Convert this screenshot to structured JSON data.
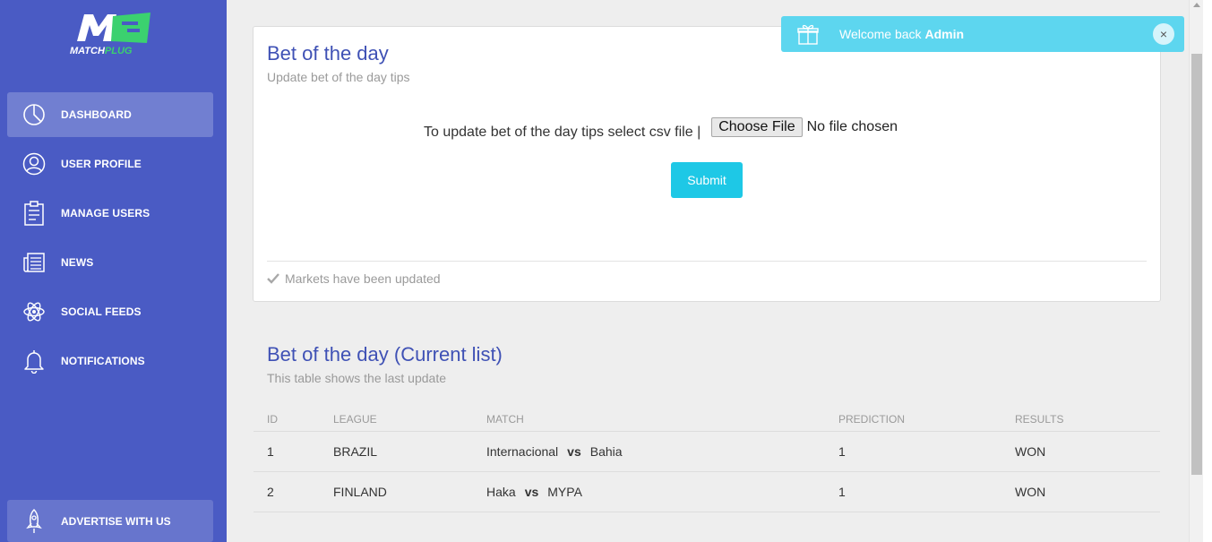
{
  "brand": {
    "logo_mark": "M",
    "logo_text_part1": "MATCH",
    "logo_text_part2": "PLUG"
  },
  "sidebar": {
    "items": [
      {
        "label": "DASHBOARD",
        "icon": "pie-chart-icon",
        "active": true
      },
      {
        "label": "USER PROFILE",
        "icon": "user-icon",
        "active": false
      },
      {
        "label": "MANAGE USERS",
        "icon": "clipboard-icon",
        "active": false
      },
      {
        "label": "NEWS",
        "icon": "newspaper-icon",
        "active": false
      },
      {
        "label": "SOCIAL FEEDS",
        "icon": "atom-icon",
        "active": false
      },
      {
        "label": "NOTIFICATIONS",
        "icon": "bell-icon",
        "active": false
      }
    ],
    "bottom_item": {
      "label": "ADVERTISE WITH US",
      "icon": "rocket-icon"
    }
  },
  "upload_card": {
    "title": "Bet of the day",
    "subtitle": "Update bet of the day tips",
    "prompt": "To update bet of the day tips select csv file |",
    "file_button": "Choose File",
    "file_status": "No file chosen",
    "submit_label": "Submit",
    "footer_note": "Markets have been updated"
  },
  "current_list": {
    "title": "Bet of the day (Current list)",
    "subtitle": "This table shows the last update",
    "columns": [
      "ID",
      "LEAGUE",
      "MATCH",
      "PREDICTION",
      "RESULTS"
    ],
    "rows": [
      {
        "id": "1",
        "league": "BRAZIL",
        "home": "Internacional",
        "vs": "vs",
        "away": "Bahia",
        "prediction": "1",
        "result": "WON"
      },
      {
        "id": "2",
        "league": "FINLAND",
        "home": "Haka",
        "vs": "vs",
        "away": "MYPA",
        "prediction": "1",
        "result": "WON"
      }
    ]
  },
  "toast": {
    "prefix": "Welcome back",
    "user": "Admin",
    "close_symbol": "×"
  },
  "colors": {
    "sidebar": "#4a5bc4",
    "accent_title": "#3f51b5",
    "submit": "#1ec8e6",
    "toast": "#5dd6ef",
    "logo_green": "#3bd16f"
  }
}
